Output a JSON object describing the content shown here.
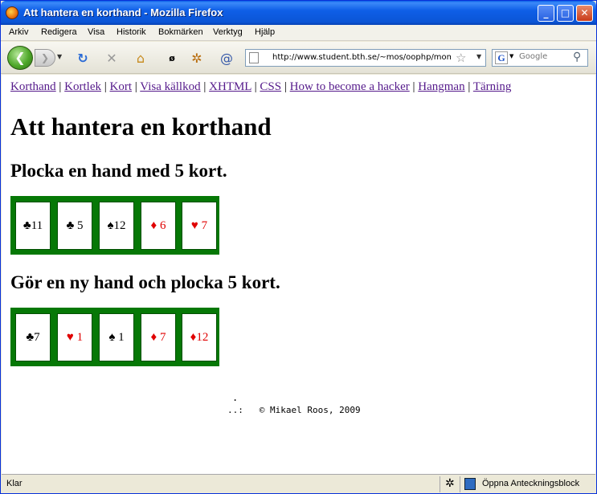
{
  "window": {
    "title": "Att hantera en korthand - Mozilla Firefox"
  },
  "menu": [
    "Arkiv",
    "Redigera",
    "Visa",
    "Historik",
    "Bokmärken",
    "Verktyg",
    "Hjälp"
  ],
  "toolbar": {
    "url": "http://www.student.bth.se/~mos/oophp/mom",
    "search_placeholder": "Google",
    "search_engine_letter": "G"
  },
  "page": {
    "nav_links": [
      "Korthand",
      "Kortlek",
      "Kort",
      "Visa källkod",
      "XHTML",
      "CSS",
      "How to become a hacker",
      "Hangman",
      "Tärning"
    ],
    "heading": "Att hantera en korthand",
    "section1": "Plocka en hand med 5 kort.",
    "section2": "Gör en ny hand och plocka 5 kort.",
    "hand1": [
      {
        "suit": "♣",
        "value": "11",
        "color": "black"
      },
      {
        "suit": "♣",
        "value": "5",
        "color": "black"
      },
      {
        "suit": "♠",
        "value": "12",
        "color": "black"
      },
      {
        "suit": "♦",
        "value": "6",
        "color": "red"
      },
      {
        "suit": "♥",
        "value": "7",
        "color": "red"
      }
    ],
    "hand2": [
      {
        "suit": "♣",
        "value": "7",
        "color": "black"
      },
      {
        "suit": "♥",
        "value": "1",
        "color": "red"
      },
      {
        "suit": "♠",
        "value": "1",
        "color": "black"
      },
      {
        "suit": "♦",
        "value": "7",
        "color": "red"
      },
      {
        "suit": "♦",
        "value": "12",
        "color": "red"
      }
    ],
    "footer_dot": ".",
    "footer": "..:   © Mikael Roos, 2009"
  },
  "status": {
    "text": "Klar",
    "notes_label": "Öppna Anteckningsblock"
  },
  "colors": {
    "hand_bg": "#067806",
    "link": "#551a8b",
    "red_suit": "#e00000"
  }
}
